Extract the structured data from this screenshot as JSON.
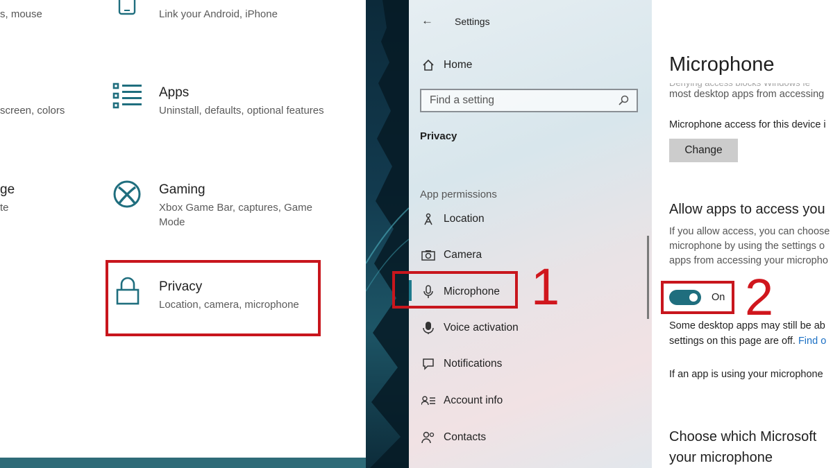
{
  "left_panel": {
    "partial_top_left": "s, mouse",
    "phone_desc": "Link your Android, iPhone",
    "phone_title": "Phone",
    "partial_mid_left": "screen, colors",
    "partial_low_left": "ge",
    "partial_low_left2": "te",
    "apps": {
      "title": "Apps",
      "desc": "Uninstall, defaults, optional features"
    },
    "gaming": {
      "title": "Gaming",
      "desc": "Xbox Game Bar, captures, Game Mode"
    },
    "privacy": {
      "title": "Privacy",
      "desc": "Location, camera, microphone"
    }
  },
  "settings": {
    "window_title": "Settings",
    "home_label": "Home",
    "search_placeholder": "Find a setting",
    "section_title": "Privacy",
    "group_label": "App permissions",
    "nav_items": [
      {
        "label": "Location",
        "icon": "location-icon"
      },
      {
        "label": "Camera",
        "icon": "camera-icon"
      },
      {
        "label": "Microphone",
        "icon": "microphone-icon",
        "selected": true
      },
      {
        "label": "Voice activation",
        "icon": "voice-activation-icon"
      },
      {
        "label": "Notifications",
        "icon": "notifications-icon"
      },
      {
        "label": "Account info",
        "icon": "account-info-icon"
      },
      {
        "label": "Contacts",
        "icon": "contacts-icon"
      }
    ]
  },
  "content": {
    "title": "Microphone",
    "cut_line": "Denying access blocks Windows fe",
    "line1": "most desktop apps from accessing",
    "access_label": "Microphone access for this device i",
    "change_button": "Change",
    "allow_heading": "Allow apps to access you",
    "allow_desc_1": "If you allow access, you can choose",
    "allow_desc_2": "microphone by using the settings o",
    "allow_desc_3": "apps from accessing your micropho",
    "toggle_label": "On",
    "toggle_state": true,
    "note_1": "Some desktop apps may still be ab",
    "note_2": "settings on this page are off.",
    "note_link": "Find o",
    "using_line": "If an app is using your microphone",
    "choose_heading_1": "Choose which Microsoft",
    "choose_heading_2": "your microphone"
  },
  "annotations": {
    "step1": "1",
    "step2": "2"
  },
  "colors": {
    "accent": "#1f6e7e",
    "highlight_red": "#c8161d"
  }
}
